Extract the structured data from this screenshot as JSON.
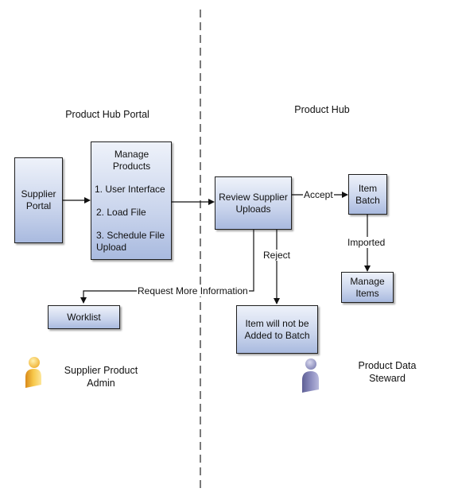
{
  "swimlanes": {
    "left_title": "Product Hub Portal",
    "right_title": "Product Hub"
  },
  "nodes": {
    "supplier_portal": {
      "label": "Supplier Portal"
    },
    "manage_products": {
      "title": "Manage Products",
      "items": [
        "1. User Interface",
        "2. Load File",
        "3. Schedule File Upload"
      ]
    },
    "review_uploads": {
      "label": "Review Supplier Uploads"
    },
    "item_batch": {
      "label": "Item Batch"
    },
    "manage_items": {
      "label": "Manage Items"
    },
    "worklist": {
      "label": "Worklist"
    },
    "not_added": {
      "label": "Item will not be Added to Batch"
    }
  },
  "edges": {
    "accept": "Accept",
    "imported": "Imported",
    "reject": "Reject",
    "request_more_info": "Request More Information"
  },
  "actors": {
    "supplier_admin": {
      "label": "Supplier Product Admin",
      "color": "#f2b632"
    },
    "data_steward": {
      "label": "Product Data Steward",
      "color": "#7e7fb0"
    }
  }
}
